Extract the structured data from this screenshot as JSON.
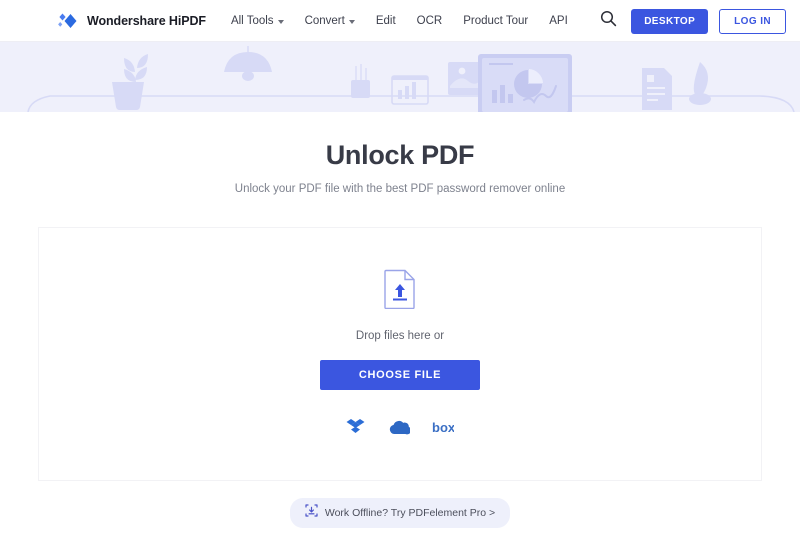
{
  "navbar": {
    "brand": {
      "name": "Wondershare HiPDF",
      "logo_icon": "wondershare-diamond-logo"
    },
    "links": [
      {
        "label": "All Tools",
        "has_caret": true
      },
      {
        "label": "Convert",
        "has_caret": true
      },
      {
        "label": "Edit",
        "has_caret": false
      },
      {
        "label": "OCR",
        "has_caret": false
      },
      {
        "label": "Product Tour",
        "has_caret": false
      },
      {
        "label": "API",
        "has_caret": false
      }
    ],
    "search_icon": "search-icon",
    "desktop_button": "DESKTOP",
    "login_button": "LOG IN",
    "accent_color": "#3b56e0"
  },
  "banner": {
    "background_color": "#eff0fb",
    "illustration_color": "#d7daf6",
    "items": [
      "plant-pot",
      "pendant-lamp",
      "pencil-cup",
      "bar-chart-card",
      "photo-frame",
      "monitor-dashboard",
      "document-page",
      "desk-vase"
    ]
  },
  "hero": {
    "title": "Unlock PDF",
    "subtitle": "Unlock your PDF file with the best PDF password remover online"
  },
  "dropzone": {
    "upload_icon": "file-upload-icon",
    "drop_text": "Drop files here or",
    "choose_file_button": "CHOOSE FILE",
    "cloud_services": [
      {
        "name": "dropbox",
        "color": "#2b6dd6"
      },
      {
        "name": "onedrive",
        "color": "#2d68c4"
      },
      {
        "name": "box",
        "color": "#3b6fc4"
      }
    ]
  },
  "footer": {
    "offline_icon": "desktop-download-icon",
    "offline_text": "Work Offline? Try PDFelement Pro >",
    "pill_color": "#eef0fb"
  }
}
